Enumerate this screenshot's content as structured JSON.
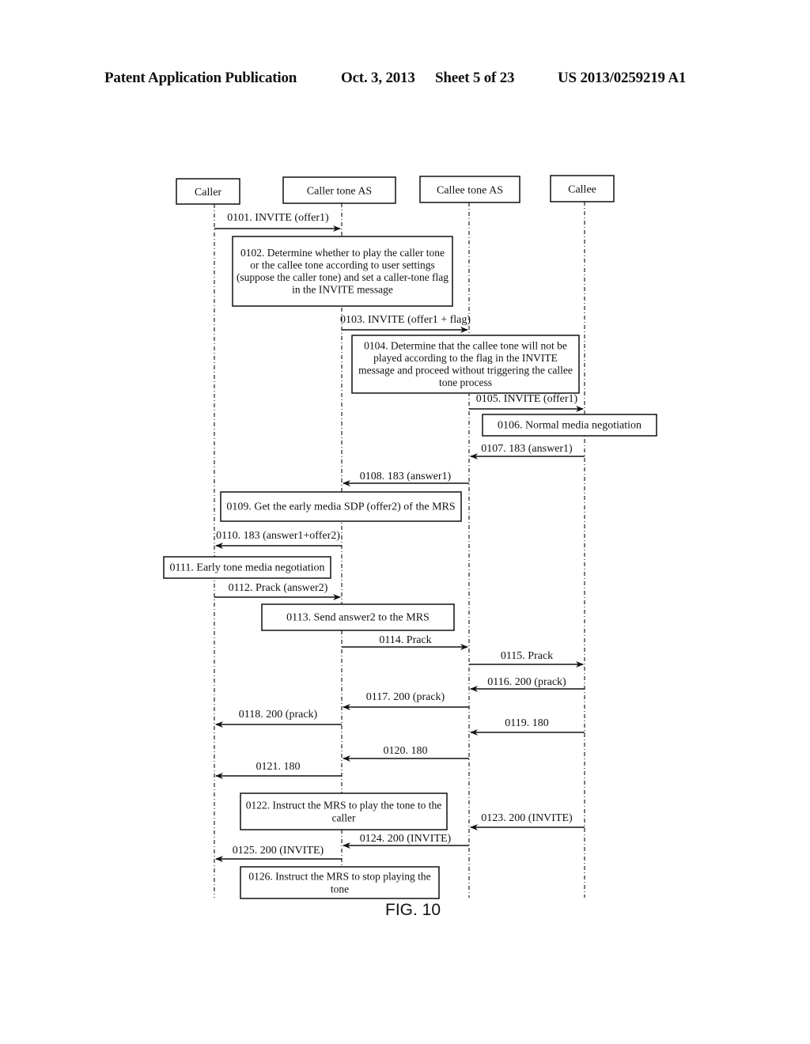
{
  "header": {
    "publication": "Patent Application Publication",
    "date": "Oct. 3, 2013",
    "sheet": "Sheet 5 of 23",
    "number": "US 2013/0259219 A1"
  },
  "figure_label": "FIG. 10",
  "participants": [
    {
      "id": "caller",
      "label": "Caller"
    },
    {
      "id": "caller_as",
      "label": "Caller tone AS"
    },
    {
      "id": "callee_as",
      "label": "Callee tone AS"
    },
    {
      "id": "callee",
      "label": "Callee"
    }
  ],
  "steps": [
    {
      "type": "msg",
      "id": "0101",
      "label": "0101. INVITE (offer1)",
      "from": "caller",
      "to": "caller_as"
    },
    {
      "type": "note",
      "id": "0102",
      "lines": [
        "0102. Determine whether to play the caller tone",
        "or the callee tone according to user settings",
        "(suppose the caller tone) and set a caller-tone flag",
        "in the INVITE message"
      ]
    },
    {
      "type": "msg",
      "id": "0103",
      "label": "0103. INVITE (offer1 + flag)",
      "from": "caller_as",
      "to": "callee_as"
    },
    {
      "type": "note",
      "id": "0104",
      "lines": [
        "0104. Determine that the callee tone will not be",
        "played according to the flag in the INVITE",
        "message and proceed without triggering the callee",
        "tone process"
      ]
    },
    {
      "type": "msg",
      "id": "0105",
      "label": "0105. INVITE (offer1)",
      "from": "callee_as",
      "to": "callee"
    },
    {
      "type": "note",
      "id": "0106",
      "lines": [
        "0106. Normal media negotiation"
      ]
    },
    {
      "type": "msg",
      "id": "0107",
      "label": "0107. 183 (answer1)",
      "from": "callee",
      "to": "callee_as"
    },
    {
      "type": "msg",
      "id": "0108",
      "label": "0108. 183 (answer1)",
      "from": "callee_as",
      "to": "caller_as"
    },
    {
      "type": "note",
      "id": "0109",
      "lines": [
        "0109. Get the early media SDP (offer2) of the MRS"
      ]
    },
    {
      "type": "msg",
      "id": "0110",
      "label": "0110. 183 (answer1+offer2)",
      "from": "caller_as",
      "to": "caller"
    },
    {
      "type": "note",
      "id": "0111",
      "lines": [
        "0111. Early tone media negotiation"
      ]
    },
    {
      "type": "msg",
      "id": "0112",
      "label": "0112. Prack (answer2)",
      "from": "caller",
      "to": "caller_as"
    },
    {
      "type": "note",
      "id": "0113",
      "lines": [
        "0113. Send answer2 to the MRS"
      ]
    },
    {
      "type": "msg",
      "id": "0114",
      "label": "0114. Prack",
      "from": "caller_as",
      "to": "callee_as"
    },
    {
      "type": "msg",
      "id": "0115",
      "label": "0115. Prack",
      "from": "callee_as",
      "to": "callee"
    },
    {
      "type": "msg",
      "id": "0116",
      "label": "0116. 200 (prack)",
      "from": "callee",
      "to": "callee_as"
    },
    {
      "type": "msg",
      "id": "0117",
      "label": "0117. 200 (prack)",
      "from": "callee_as",
      "to": "caller_as"
    },
    {
      "type": "msg",
      "id": "0118",
      "label": "0118. 200 (prack)",
      "from": "caller_as",
      "to": "caller"
    },
    {
      "type": "msg",
      "id": "0119",
      "label": "0119. 180",
      "from": "callee",
      "to": "callee_as"
    },
    {
      "type": "msg",
      "id": "0120",
      "label": "0120. 180",
      "from": "callee_as",
      "to": "caller_as"
    },
    {
      "type": "msg",
      "id": "0121",
      "label": "0121. 180",
      "from": "caller_as",
      "to": "caller"
    },
    {
      "type": "note",
      "id": "0122",
      "lines": [
        "0122. Instruct the MRS to play the tone to the",
        "caller"
      ]
    },
    {
      "type": "msg",
      "id": "0123",
      "label": "0123. 200 (INVITE)",
      "from": "callee",
      "to": "callee_as"
    },
    {
      "type": "msg",
      "id": "0124",
      "label": "0124. 200 (INVITE)",
      "from": "callee_as",
      "to": "caller_as"
    },
    {
      "type": "msg",
      "id": "0125",
      "label": "0125. 200 (INVITE)",
      "from": "caller_as",
      "to": "caller"
    },
    {
      "type": "note",
      "id": "0126",
      "lines": [
        "0126. Instruct the MRS to stop playing the",
        "tone"
      ]
    }
  ]
}
